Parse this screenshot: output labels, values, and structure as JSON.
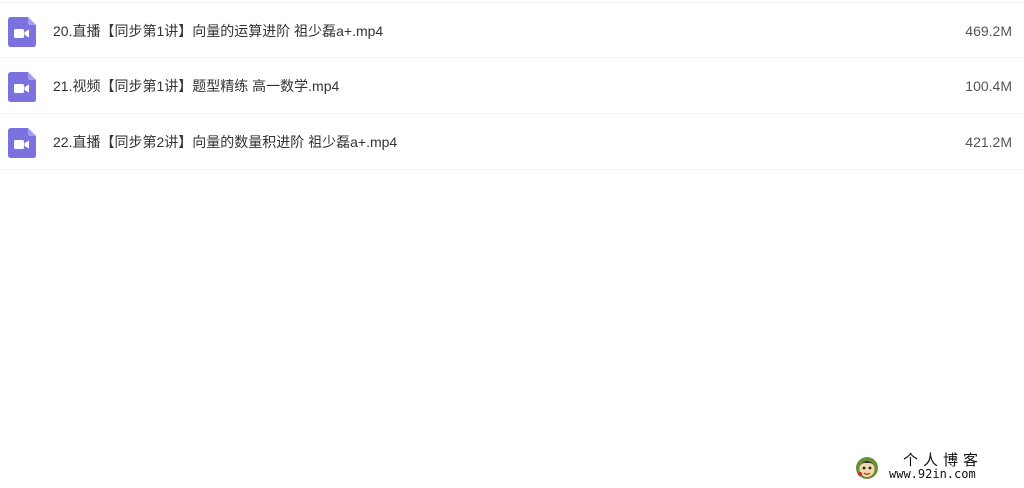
{
  "files": [
    {
      "name": "20.直播【同步第1讲】向量的运算进阶 祖少磊a+.mp4",
      "size": "469.2M",
      "icon": "video-file-icon"
    },
    {
      "name": "21.视频【同步第1讲】题型精练 高一数学.mp4",
      "size": "100.4M",
      "icon": "video-file-icon"
    },
    {
      "name": "22.直播【同步第2讲】向量的数量积进阶 祖少磊a+.mp4",
      "size": "421.2M",
      "icon": "video-file-icon"
    }
  ],
  "colors": {
    "icon_bg": "#7b72e0",
    "icon_fold": "#a59ff0"
  },
  "watermark": {
    "title": "个人博客",
    "url": "www.92in.com"
  }
}
